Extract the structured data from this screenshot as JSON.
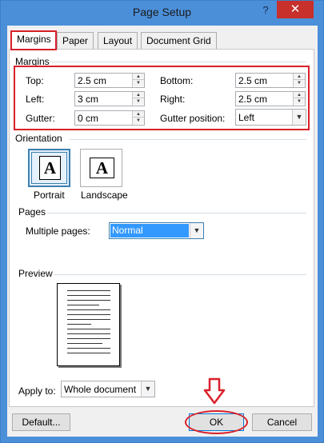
{
  "window": {
    "title": "Page Setup",
    "help": "?",
    "close": "✕"
  },
  "tabs": [
    {
      "label": "Margins"
    },
    {
      "label": "Paper"
    },
    {
      "label": "Layout"
    },
    {
      "label": "Document Grid"
    }
  ],
  "margins": {
    "group_title": "Margins",
    "top": {
      "label": "Top:",
      "value": "2.5 cm"
    },
    "bottom": {
      "label": "Bottom:",
      "value": "2.5 cm"
    },
    "left": {
      "label": "Left:",
      "value": "3 cm"
    },
    "right": {
      "label": "Right:",
      "value": "2.5 cm"
    },
    "gutter": {
      "label": "Gutter:",
      "value": "0 cm"
    },
    "gutter_position": {
      "label": "Gutter position:",
      "value": "Left"
    }
  },
  "orientation": {
    "group_title": "Orientation",
    "portrait": {
      "label": "Portrait",
      "glyph": "A"
    },
    "landscape": {
      "label": "Landscape",
      "glyph": "A"
    }
  },
  "pages": {
    "group_title": "Pages",
    "multiple_pages": {
      "label": "Multiple pages:",
      "value": "Normal"
    }
  },
  "preview": {
    "group_title": "Preview"
  },
  "apply_to": {
    "label": "Apply to:",
    "value": "Whole document"
  },
  "buttons": {
    "default": "Default...",
    "ok": "OK",
    "cancel": "Cancel"
  },
  "colors": {
    "annotation_red": "#d9202a",
    "title_blue": "#4b8fd9",
    "selection_blue": "#3399ff"
  }
}
